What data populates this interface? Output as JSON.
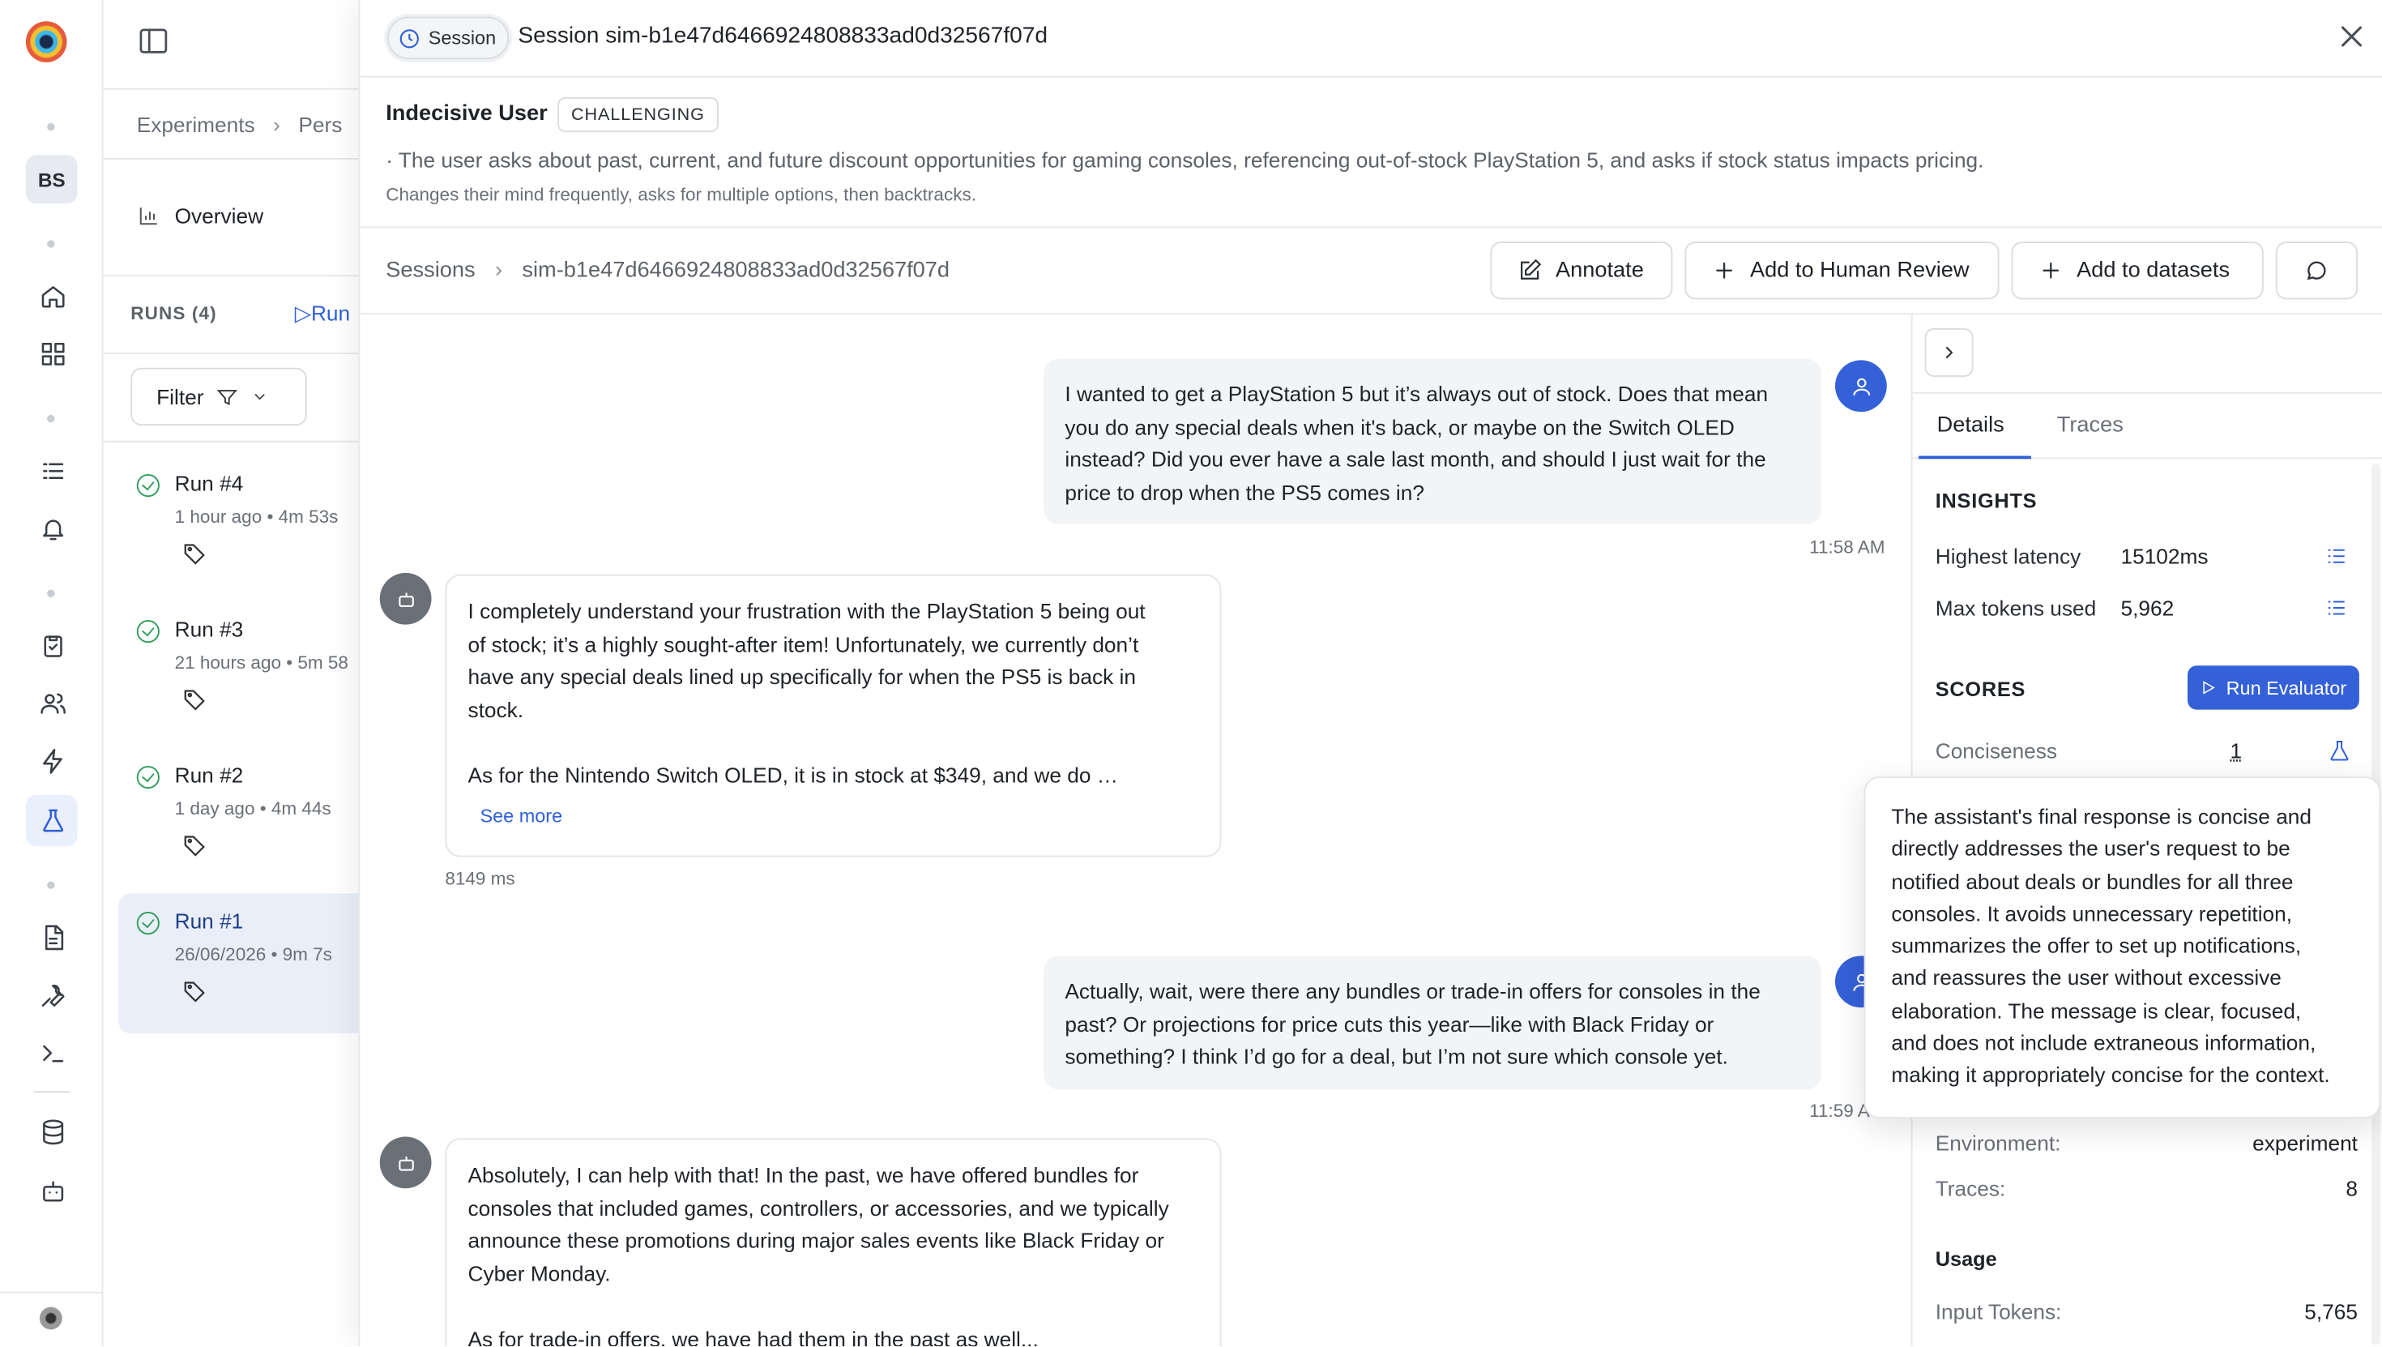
{
  "nav": {
    "avatar_initials": "BS",
    "icons": [
      "home-icon",
      "dashboard-icon",
      "list-icon",
      "bell-icon",
      "clipboard-icon",
      "users-icon",
      "bolt-icon",
      "flask-icon",
      "document-icon",
      "wrench-icon",
      "terminal-icon",
      "database-icon",
      "bot-icon"
    ]
  },
  "sidebar": {
    "breadcrumb": [
      "Experiments",
      "Pers"
    ],
    "overview_label": "Overview",
    "runs_header": "RUNS (4)",
    "run_link": "Run",
    "filter_label": "Filter",
    "runs": [
      {
        "name": "Run #4",
        "meta": "1 hour ago • 4m 53s",
        "selected": false
      },
      {
        "name": "Run #3",
        "meta": "21 hours ago • 5m 58",
        "selected": false
      },
      {
        "name": "Run #2",
        "meta": "1 day ago • 4m 44s",
        "selected": false
      },
      {
        "name": "Run #1",
        "meta": "26/06/2026 • 9m 7s",
        "selected": true
      }
    ]
  },
  "drawer": {
    "pill_label": "Session",
    "title": "Session sim-b1e47d6466924808833ad0d32567f07d",
    "persona": {
      "name": "Indecisive User",
      "badge": "CHALLENGING",
      "description": "· The user asks about past, current, and future discount opportunities for gaming consoles, referencing out-of-stock PlayStation 5, and asks if stock status impacts pricing.",
      "trait": "Changes their mind frequently, asks for multiple options, then backtracks."
    },
    "breadcrumb": [
      "Sessions",
      "sim-b1e47d6466924808833ad0d32567f07d"
    ],
    "actions": {
      "annotate": "Annotate",
      "human_review": "Add to Human Review",
      "datasets": "Add to datasets"
    }
  },
  "chat": {
    "messages": [
      {
        "role": "user",
        "lines": [
          "I wanted to get a PlayStation 5 but it’s always out of stock. Does that mean",
          "you do any special deals when it's back, or maybe on the Switch OLED",
          "instead? Did you ever have a sale last month, and should I just wait for the",
          "price to drop when the PS5 comes in?"
        ],
        "time": "11:58 AM"
      },
      {
        "role": "assistant",
        "lines": [
          "I completely understand your frustration with the PlayStation 5 being out",
          "of stock; it’s a highly sought-after item! Unfortunately, we currently don’t",
          "have any special deals lined up specifically for when the PS5 is back in",
          "stock.",
          "",
          "As for the Nintendo Switch OLED, it is in stock at $349, and we do …"
        ],
        "see_more": "See more",
        "latency": "8149 ms"
      },
      {
        "role": "user",
        "lines": [
          "Actually, wait, were there any bundles or trade-in offers for consoles in the",
          "past? Or projections for price cuts this year—like with Black Friday or",
          "something? I think I’d go for a deal, but I’m not sure which console yet."
        ],
        "time": "11:59 A"
      },
      {
        "role": "assistant",
        "lines": [
          "Absolutely, I can help with that! In the past, we have offered bundles for",
          "consoles that included games, controllers, or accessories, and we typically",
          "announce these promotions during major sales events like Black Friday or",
          "Cyber Monday.",
          "",
          "As for trade-in offers, we have had them in the past as well..."
        ]
      }
    ]
  },
  "details": {
    "tabs": [
      "Details",
      "Traces"
    ],
    "insights_title": "INSIGHTS",
    "highest_latency_label": "Highest latency",
    "highest_latency_value": "15102ms",
    "max_tokens_label": "Max tokens used",
    "max_tokens_value": "5,962",
    "scores_title": "SCORES",
    "run_evaluator": "Run Evaluator",
    "conciseness_label": "Conciseness",
    "conciseness_value": "1",
    "environment_label": "Environment:",
    "environment_value": "experiment",
    "traces_label": "Traces:",
    "traces_value": "8",
    "usage_title": "Usage",
    "input_tokens_label": "Input Tokens:",
    "input_tokens_value": "5,765"
  },
  "tooltip": {
    "lines": [
      "The assistant's final response is concise and",
      "directly addresses the user's request to be",
      "notified about deals or bundles for all three",
      "consoles. It avoids unnecessary repetition,",
      "summarizes the offer to set up notifications,",
      "and reassures the user without excessive",
      "elaboration. The message is clear, focused,",
      "and does not include extraneous information,",
      "making it appropriately concise for the context."
    ]
  },
  "colors": {
    "accent": "#3561d8",
    "success": "#2e9e5b"
  }
}
